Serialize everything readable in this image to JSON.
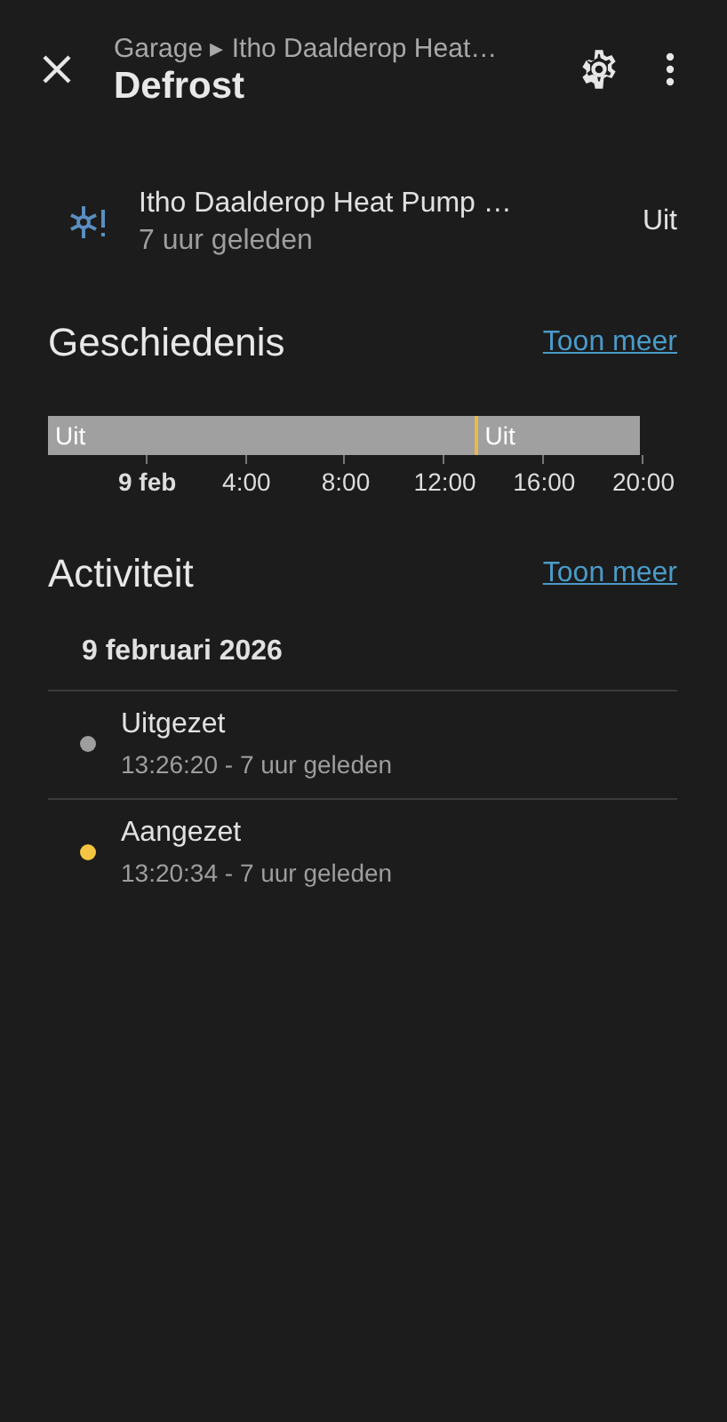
{
  "header": {
    "breadcrumb": "Garage ▸ Itho Daalderop Heat…",
    "title": "Defrost"
  },
  "entity": {
    "name": "Itho Daalderop Heat Pump …",
    "time": "7 uur geleden",
    "state": "Uit"
  },
  "history": {
    "title": "Geschiedenis",
    "link": "Toon meer",
    "segments": [
      {
        "label": "Uit",
        "color": "#a0a0a0",
        "kind": "state"
      },
      {
        "color": "#e8b84a",
        "kind": "marker"
      },
      {
        "label": "Uit",
        "color": "#a0a0a0",
        "kind": "state"
      }
    ],
    "ticks": [
      {
        "label": "9 feb",
        "kind": "date"
      },
      {
        "label": "4:00",
        "kind": "time"
      },
      {
        "label": "8:00",
        "kind": "time"
      },
      {
        "label": "12:00",
        "kind": "time"
      },
      {
        "label": "16:00",
        "kind": "time"
      },
      {
        "label": "20:00",
        "kind": "time"
      }
    ]
  },
  "activity": {
    "title": "Activiteit",
    "link": "Toon meer",
    "date": "9 februari 2026",
    "items": [
      {
        "title": "Uitgezet",
        "time": "13:26:20 - 7 uur geleden",
        "color": "#9e9e9e"
      },
      {
        "title": "Aangezet",
        "time": "13:20:34 - 7 uur geleden",
        "color": "#f4c542"
      }
    ]
  }
}
